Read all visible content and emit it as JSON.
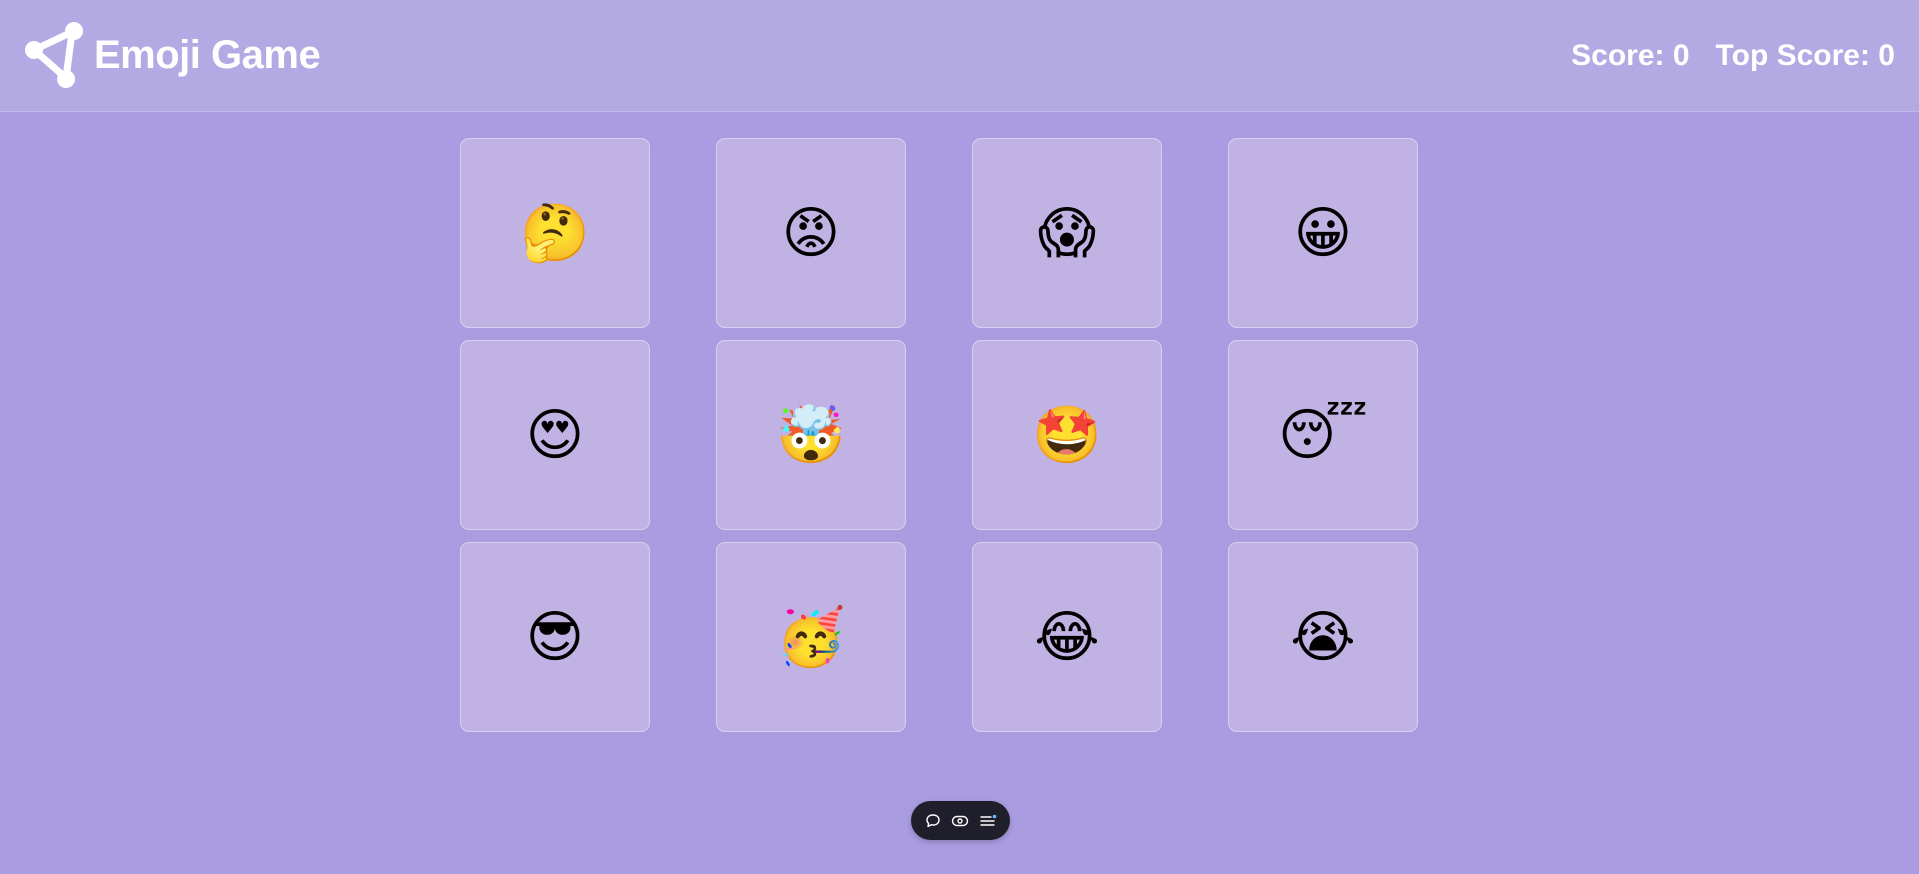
{
  "header": {
    "title": "Emoji Game",
    "score_label": "Score: 0",
    "top_score_label": "Top Score: 0",
    "logo_icon": "share-nodes-icon"
  },
  "emojis": [
    {
      "name": "face-with-hand-over-mouth-thinking",
      "glyph": "🤔"
    },
    {
      "name": "angry-face",
      "glyph": "😡"
    },
    {
      "name": "face-screaming-in-fear",
      "glyph": "😱"
    },
    {
      "name": "grinning-face",
      "glyph": "😀"
    },
    {
      "name": "heart-eyes-face",
      "glyph": "😍"
    },
    {
      "name": "exploding-head",
      "glyph": "🤯"
    },
    {
      "name": "star-struck",
      "glyph": "🤩"
    },
    {
      "name": "sleeping-face",
      "glyph": "😴"
    },
    {
      "name": "smiling-face-with-sunglasses",
      "glyph": "😎"
    },
    {
      "name": "partying-face",
      "glyph": "🥳"
    },
    {
      "name": "face-with-tears-of-joy",
      "glyph": "😂"
    },
    {
      "name": "loudly-crying-face",
      "glyph": "😭"
    }
  ],
  "toolbar": {
    "icons": [
      "comment-icon",
      "toggle-view-icon",
      "menu-list-icon"
    ]
  },
  "colors": {
    "background": "#a99ce0",
    "header": "#b3aae4",
    "card": "#c0b3e3",
    "toolbar": "#1f1e2b",
    "text": "#ffffff"
  }
}
